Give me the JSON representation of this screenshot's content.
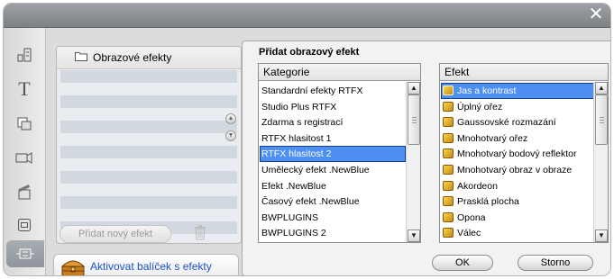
{
  "window": {
    "close_symbol": "✕"
  },
  "toolbar": {
    "tools": [
      {
        "name": "scene-editor-icon"
      },
      {
        "name": "title-text-icon",
        "glyph": "T"
      },
      {
        "name": "transitions-icon"
      },
      {
        "name": "audio-icon"
      },
      {
        "name": "clapboard-icon"
      },
      {
        "name": "window-icon"
      },
      {
        "name": "effects-tool-icon",
        "active": true
      }
    ]
  },
  "left_panel": {
    "title": "Obrazové efekty",
    "add_effect_label": "Přidat nový efekt",
    "activate_pack_label": "Aktivovat balíček s efekty"
  },
  "right_panel": {
    "title": "Přidat obrazový efekt",
    "category": {
      "header": "Kategorie",
      "selected_index": 4,
      "items": [
        "Standardní efekty RTFX",
        "Studio Plus RTFX",
        "Zdarma s registrací",
        "RTFX hlasitost 1",
        "RTFX hlasitost 2",
        "Umělecký efekt .NewBlue",
        "Efekt .NewBlue",
        "Časový efekt .NewBlue",
        "BWPLUGINS",
        "BWPLUGINS 2"
      ]
    },
    "effect": {
      "header": "Efekt",
      "selected_index": 0,
      "items": [
        "Jas a kontrast",
        "Úplný ořez",
        "Gaussovské rozmazání",
        "Mnohotvarý ořez",
        "Mnohotvarý bodový reflektor",
        "Mnohotvarý obraz v obraze",
        "Akordeon",
        "Prasklá plocha",
        "Opona",
        "Válec"
      ]
    },
    "ok_label": "OK",
    "cancel_label": "Storno"
  },
  "colors": {
    "selection": "#4e8ff2",
    "link": "#1b52c8",
    "titlebar": "#8b8f93"
  }
}
